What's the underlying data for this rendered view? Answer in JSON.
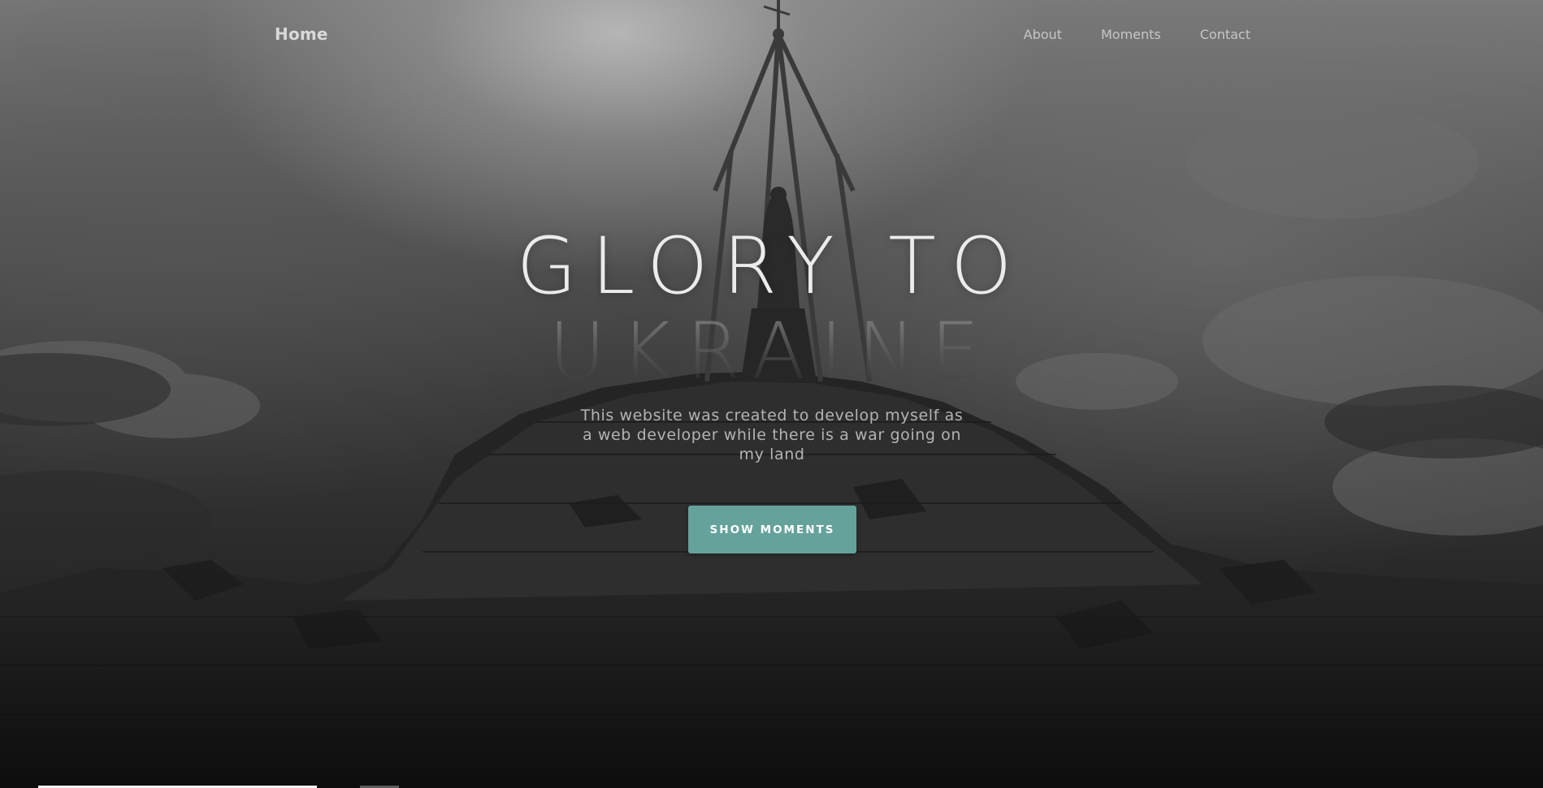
{
  "nav": {
    "home_label": "Home",
    "links": [
      {
        "label": "About"
      },
      {
        "label": "Moments"
      },
      {
        "label": "Contact"
      }
    ]
  },
  "hero": {
    "title_line1": "GLORY TO",
    "title_line2": "UKRAINE",
    "subtitle": "This website was created to develop myself as a web developer while there is a war going on my land",
    "button_label": "SHOW MOMENTS"
  },
  "colors": {
    "accent": "#65a29c",
    "title": "#ebebeb",
    "subtitle": "#b3b3b3"
  },
  "icons": {
    "background": "mountain-shrine-image"
  }
}
